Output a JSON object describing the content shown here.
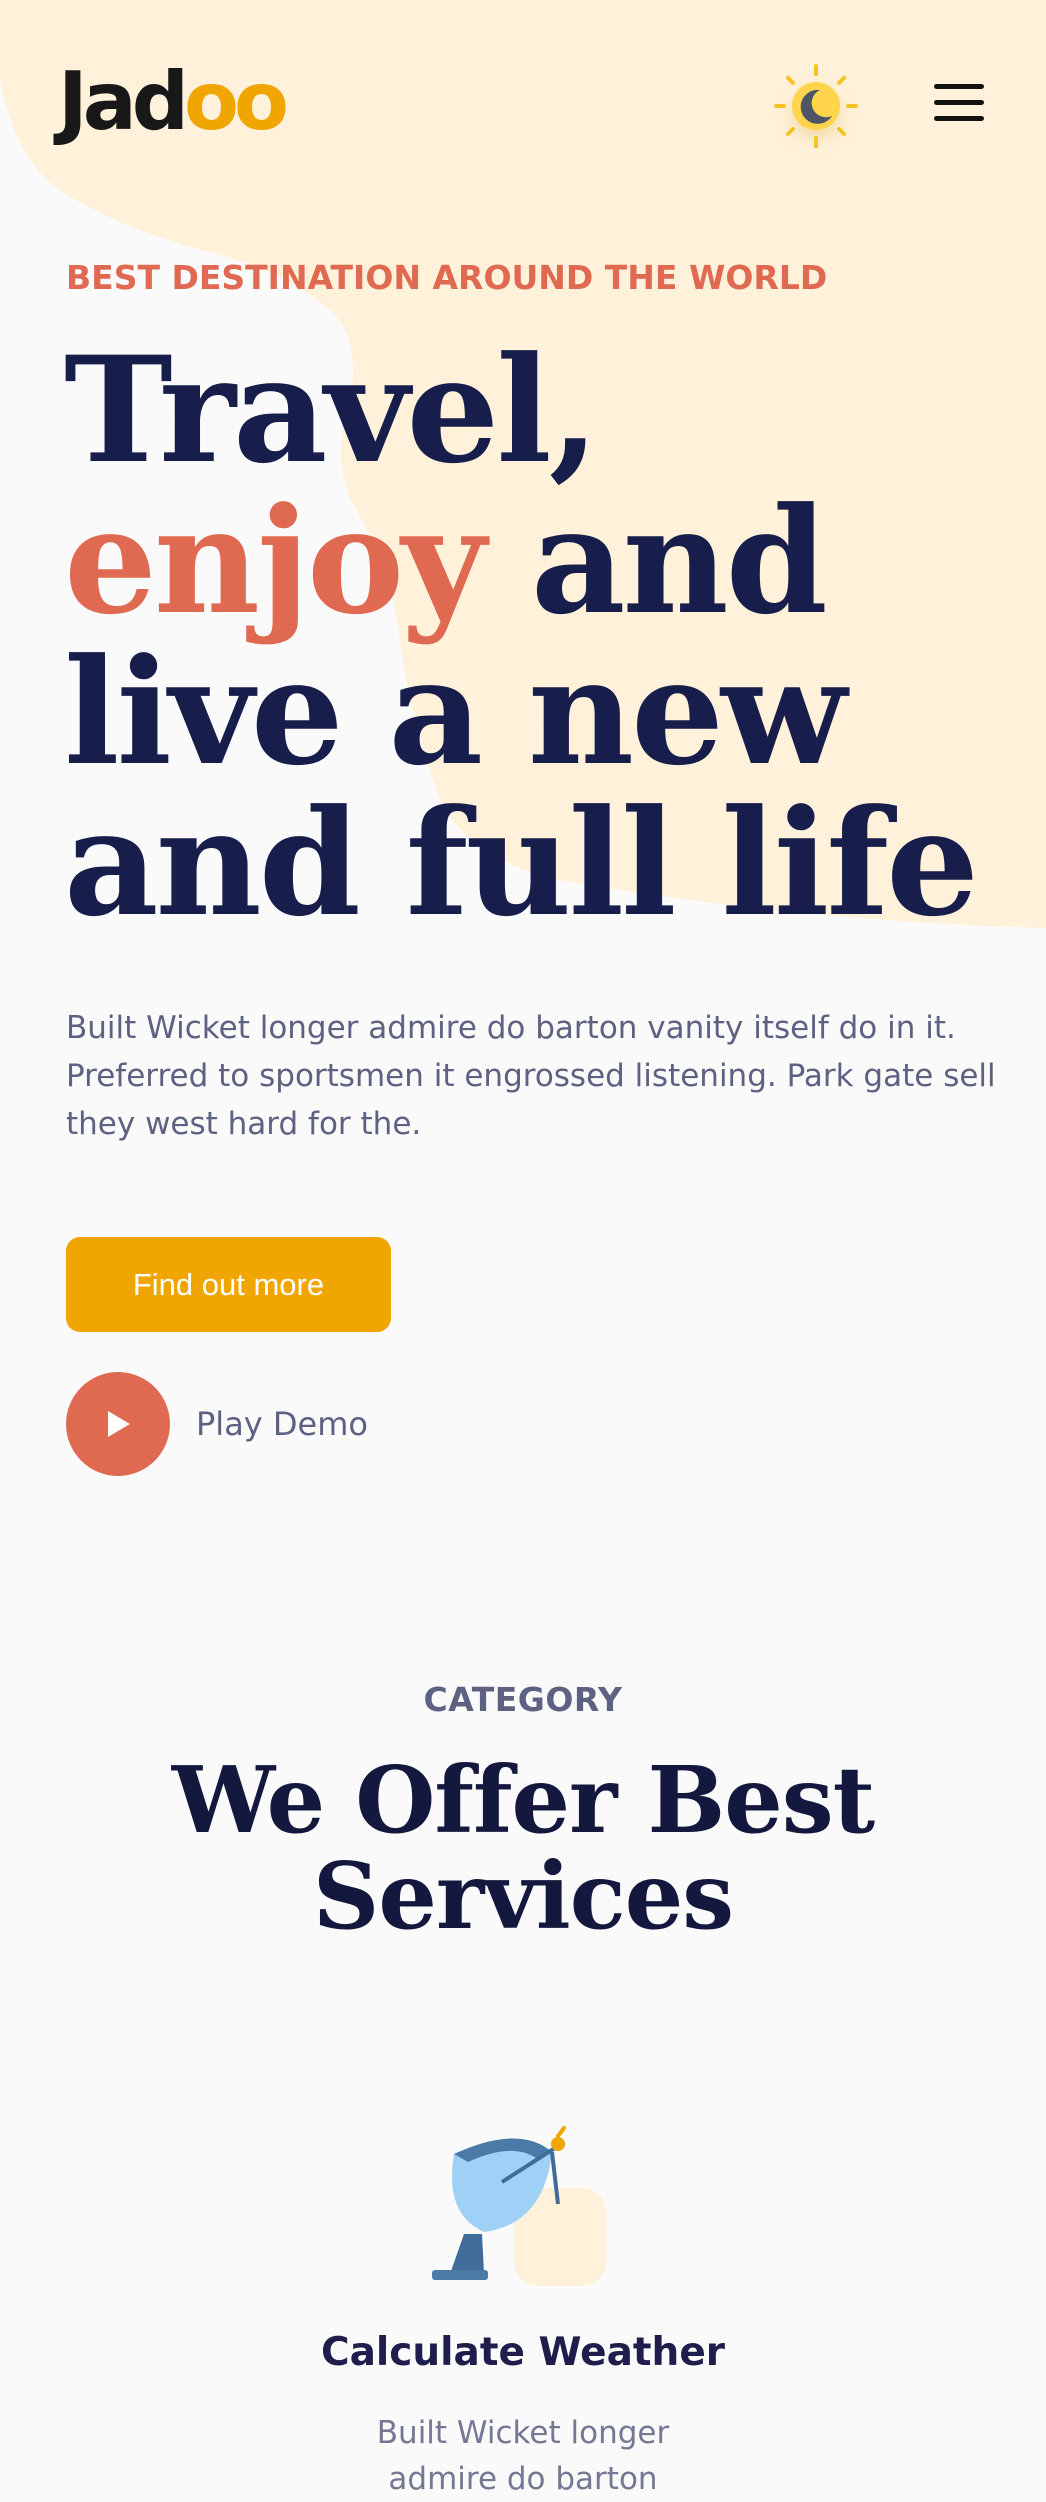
{
  "header": {
    "logo_main": "Jad",
    "logo_accent": "oo",
    "theme_toggle_icon": "sun-moon-icon",
    "menu_icon": "hamburger-menu-icon"
  },
  "hero": {
    "tagline": "BEST DESTINATION AROUND THE WORLD",
    "headline_line1": "Travel,",
    "headline_accent": "enjoy",
    "headline_line2_rest": " and",
    "headline_line3": "live a new",
    "headline_line4": "and full life",
    "description": "Built Wicket longer admire do barton vanity itself do in it. Preferred to sportsmen it engrossed listening. Park gate sell they west hard for the.",
    "cta_label": "Find out more",
    "play_label": "Play Demo"
  },
  "category": {
    "label": "CATEGORY",
    "title": "We Offer Best Services",
    "service": {
      "icon": "satellite-dish-icon",
      "title": "Calculate Weather",
      "description": "Built Wicket longer admire do barton"
    }
  },
  "colors": {
    "accent_orange": "#df6951",
    "cta_yellow": "#f1a501",
    "heading_navy": "#181e4b",
    "text_grey": "#5e6282",
    "blob_cream": "#fff1da"
  }
}
